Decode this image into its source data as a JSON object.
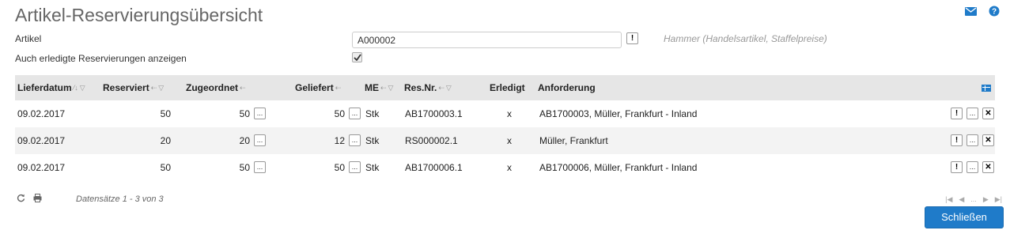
{
  "title": "Artikel-Reservierungsübersicht",
  "top_icons": [
    "mail-icon",
    "help-icon"
  ],
  "form": {
    "artikel_label": "Artikel",
    "artikel_value": "A000002",
    "artikel_btn": "!",
    "artikel_desc": "Hammer (Handelsartikel, Staffelpreise)",
    "erledigt_label": "Auch erledigte Reservierungen anzeigen",
    "erledigt_checked": true
  },
  "columns": {
    "lieferdatum": "Lieferdatum",
    "reserviert": "Reserviert",
    "zugeordnet": "Zugeordnet",
    "geliefert": "Geliefert",
    "me": "ME",
    "resnr": "Res.Nr.",
    "erledigt": "Erledigt",
    "anforderung": "Anforderung"
  },
  "rows": [
    {
      "lieferdatum": "09.02.2017",
      "reserviert": "50",
      "zugeordnet": "50",
      "geliefert": "50",
      "me": "Stk",
      "resnr": "AB1700003.1",
      "erledigt": "x",
      "anforderung": "AB1700003, Müller, Frankfurt - Inland"
    },
    {
      "lieferdatum": "09.02.2017",
      "reserviert": "20",
      "zugeordnet": "20",
      "geliefert": "12",
      "me": "Stk",
      "resnr": "RS000002.1",
      "erledigt": "x",
      "anforderung": "Müller, Frankfurt"
    },
    {
      "lieferdatum": "09.02.2017",
      "reserviert": "50",
      "zugeordnet": "50",
      "geliefert": "50",
      "me": "Stk",
      "resnr": "AB1700006.1",
      "erledigt": "x",
      "anforderung": "AB1700006, Müller, Frankfurt - Inland"
    }
  ],
  "row_buttons": {
    "excl": "!",
    "dots": "...",
    "x": "✕"
  },
  "footer": {
    "records": "Datensätze 1 - 3 von 3",
    "pager_dots": "..."
  },
  "close_label": "Schließen",
  "colors": {
    "accent": "#1f7bc9",
    "header_bg": "#e6e6e6"
  }
}
